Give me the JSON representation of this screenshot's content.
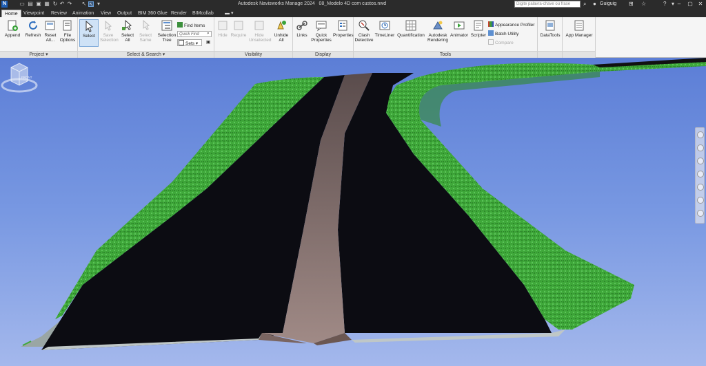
{
  "window": {
    "app_title": "Autodesk Navisworks Manage 2024",
    "file_name": "08_Modelo 4D com custos.nwd",
    "logo_text": "N",
    "search_placeholder": "Digite palavra-chave ou frase",
    "user_name": "Guiguig"
  },
  "tabs": [
    {
      "label": "Home",
      "active": true
    },
    {
      "label": "Viewpoint"
    },
    {
      "label": "Review"
    },
    {
      "label": "Animation"
    },
    {
      "label": "View"
    },
    {
      "label": "Output"
    },
    {
      "label": "BIM 360 Glue"
    },
    {
      "label": "Render"
    },
    {
      "label": "BIMcollab"
    }
  ],
  "ribbon": {
    "project": {
      "label": "Project ▾",
      "append": "Append",
      "refresh": "Refresh",
      "reset_all": "Reset All...",
      "file_options": "File Options"
    },
    "select_search": {
      "label": "Select & Search ▾",
      "select": "Select",
      "save_selection": "Save Selection",
      "select_all": "Select All",
      "select_same": "Select Same",
      "selection_tree": "Selection Tree",
      "find_items": "Find Items",
      "quick_find_placeholder": "Quick Find",
      "sets": "Sets"
    },
    "visibility": {
      "label": "Visibility",
      "hide": "Hide",
      "require": "Require",
      "hide_unselected": "Hide Unselected",
      "unhide_all": "Unhide All"
    },
    "display": {
      "label": "Display",
      "links": "Links",
      "quick_properties": "Quick Properties",
      "properties": "Properties"
    },
    "tools": {
      "label": "Tools",
      "clash_detective": "Clash Detective",
      "timeliner": "TimeLiner",
      "quantification": "Quantification",
      "autodesk_rendering": "Autodesk Rendering",
      "animator": "Animator",
      "scripter": "Scripter",
      "appearance_profiler": "Appearance Profiler",
      "batch_utility": "Batch Utility",
      "compare": "Compare"
    },
    "extras": {
      "datatools": "DataTools",
      "app_manager": "App Manager"
    }
  },
  "viewport": {
    "viewcube_label": "FRONT",
    "sky_color": "#6e8fdd",
    "asphalt_color": "#0c0c12",
    "median_color": "#8c7774",
    "grass_color": "#3fae3f"
  }
}
